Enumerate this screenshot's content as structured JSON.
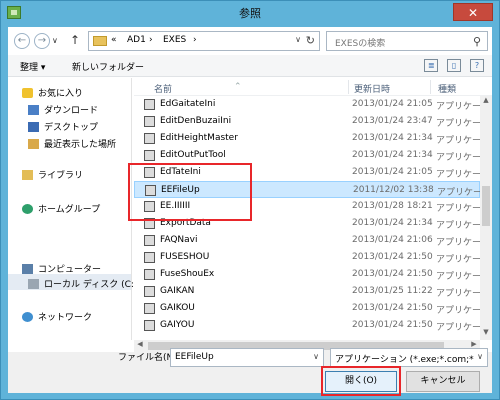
{
  "window": {
    "title": "参照",
    "close": "✕"
  },
  "nav": {
    "address": {
      "prefix": "«",
      "crumb1": "AD1",
      "sep1": "›",
      "crumb2": "EXES",
      "sep2": "›",
      "dropdown": "∨",
      "refresh": "↻"
    },
    "search_placeholder": "EXESの検索"
  },
  "toolbar": {
    "organize": "整理 ▾",
    "new_folder": "新しいフォルダー"
  },
  "sidebar": {
    "favorites": "お気に入り",
    "downloads": "ダウンロード",
    "desktop": "デスクトップ",
    "recent": "最近表示した場所",
    "libraries": "ライブラリ",
    "homegroup": "ホームグループ",
    "computer": "コンピューター",
    "local_disk": "ローカル ディスク (C:)",
    "network": "ネットワーク"
  },
  "columns": {
    "name": "名前",
    "date": "更新日時",
    "type": "種類"
  },
  "files": [
    {
      "name": "EdGaitateIni",
      "date": "2013/01/24 21:05",
      "type": "アプリケーシ"
    },
    {
      "name": "EditDenBuzaiIni",
      "date": "2013/01/24 23:47",
      "type": "アプリケーシ"
    },
    {
      "name": "EditHeightMaster",
      "date": "2013/01/24 21:34",
      "type": "アプリケーシ"
    },
    {
      "name": "EditOutPutTool",
      "date": "2013/01/24 21:34",
      "type": "アプリケーシ"
    },
    {
      "name": "EdTateIni",
      "date": "2013/01/24 21:05",
      "type": "アプリケーシ"
    },
    {
      "name": "EEFileUp",
      "date": "2011/12/02 13:38",
      "type": "アプリケーシ"
    },
    {
      "name": "EE.IIIIII",
      "date": "2013/01/28 18:21",
      "type": "アプリケーシ"
    },
    {
      "name": "ExportData",
      "date": "2013/01/24 21:34",
      "type": "アプリケーシ"
    },
    {
      "name": "FAQNavi",
      "date": "2013/01/24 21:06",
      "type": "アプリケーシ"
    },
    {
      "name": "FUSESHOU",
      "date": "2013/01/24 21:50",
      "type": "アプリケーシ"
    },
    {
      "name": "FuseShouEx",
      "date": "2013/01/24 21:50",
      "type": "アプリケーシ"
    },
    {
      "name": "GAIKAN",
      "date": "2013/01/25 11:22",
      "type": "アプリケーシ"
    },
    {
      "name": "GAIKOU",
      "date": "2013/01/24 21:50",
      "type": "アプリケーシ"
    },
    {
      "name": "GAIYOU",
      "date": "2013/01/24 21:50",
      "type": "アプリケーシ"
    }
  ],
  "filename": {
    "label": "ファイル名(N):",
    "value": "EEFileUp",
    "dropdown": "∨"
  },
  "filter": {
    "value": "アプリケーション (*.exe;*.com;*",
    "dropdown": "∨"
  },
  "buttons": {
    "open": "開く(O)",
    "cancel": "キャンセル"
  }
}
